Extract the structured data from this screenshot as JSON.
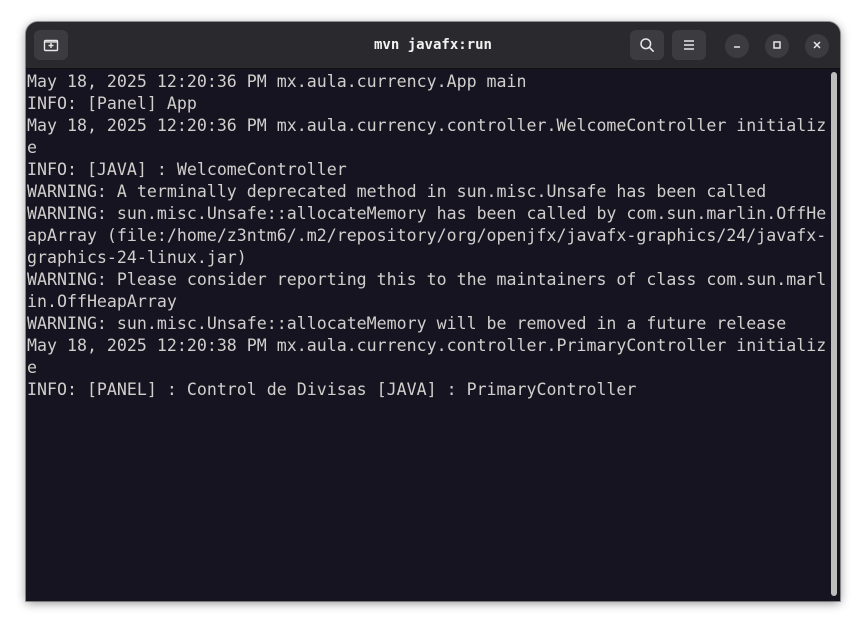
{
  "window": {
    "title": "mvn javafx:run"
  },
  "headerbar": {
    "new_tab_icon": "new-tab-icon",
    "search_icon": "search-icon",
    "menu_icon": "hamburger-menu-icon",
    "minimize_icon": "minimize-icon",
    "maximize_icon": "maximize-icon",
    "close_icon": "close-icon"
  },
  "terminal": {
    "lines": [
      "May 18, 2025 12:20:36 PM mx.aula.currency.App main",
      "INFO: [Panel] App",
      "May 18, 2025 12:20:36 PM mx.aula.currency.controller.WelcomeController initializ",
      "e",
      "INFO: [JAVA] : WelcomeController",
      "WARNING: A terminally deprecated method in sun.misc.Unsafe has been called",
      "WARNING: sun.misc.Unsafe::allocateMemory has been called by com.sun.marlin.OffHe",
      "apArray (file:/home/z3ntm6/.m2/repository/org/openjfx/javafx-graphics/24/javafx-",
      "graphics-24-linux.jar)",
      "WARNING: Please consider reporting this to the maintainers of class com.sun.marl",
      "in.OffHeapArray",
      "WARNING: sun.misc.Unsafe::allocateMemory will be removed in a future release",
      "May 18, 2025 12:20:38 PM mx.aula.currency.controller.PrimaryController initializ",
      "e",
      "INFO: [PANEL] : Control de Divisas [JAVA] : PrimaryController"
    ]
  },
  "colors": {
    "terminal_background": "#171421",
    "terminal_foreground": "#d0cfcc",
    "headerbar_background": "#2a2a2e"
  }
}
